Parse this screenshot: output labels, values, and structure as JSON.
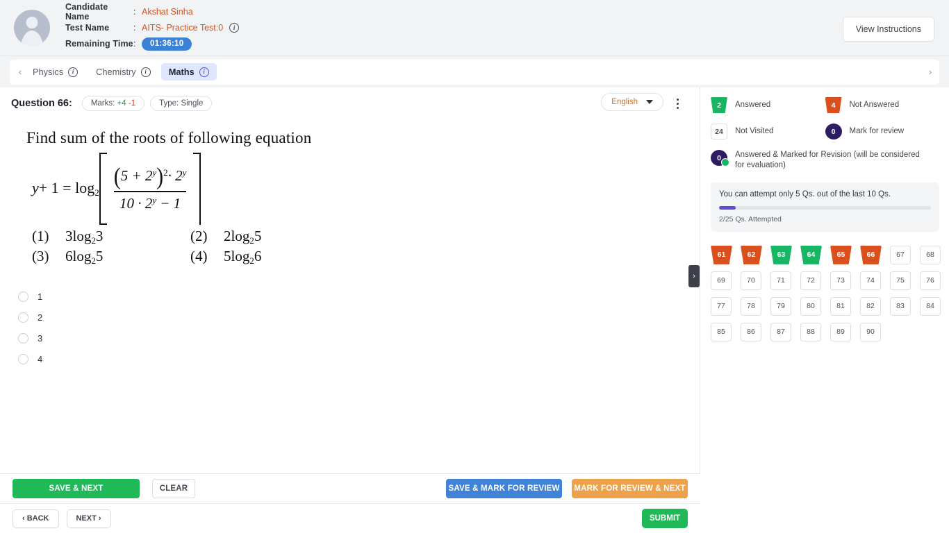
{
  "header": {
    "candidate_label": "Candidate Name",
    "candidate_name": "Akshat Sinha",
    "test_label": "Test Name",
    "test_name": "AITS- Practice Test:0",
    "time_label": "Remaining Time",
    "remaining_time": "01:36:10",
    "colon": ":",
    "view_instructions": "View Instructions",
    "info_glyph": "i"
  },
  "tabs": {
    "prev_arrow": "‹",
    "next_arrow": "›",
    "items": [
      {
        "label": "Physics",
        "active": false
      },
      {
        "label": "Chemistry",
        "active": false
      },
      {
        "label": "Maths",
        "active": true
      }
    ]
  },
  "question": {
    "title": "Question 66:",
    "marks_label": "Marks:",
    "marks_positive": "+4",
    "marks_negative": "-1",
    "type_label": "Type:",
    "type_value": "Single",
    "language": "English",
    "stem": "Find sum of the roots of following equation",
    "equation": {
      "lhs_y": "y",
      "lhs_plus1": "+ 1 =",
      "log": "log",
      "log_base": "2",
      "numerator_open": "(",
      "numerator_5plus2": "5 + 2",
      "numerator_exp_y": "y",
      "numerator_close": ")",
      "numerator_power": "2",
      "numerator_dot2": "· 2",
      "numerator_dot2_exp": "y",
      "denominator": "10 · 2",
      "denominator_exp": "y",
      "denominator_minus": "− 1"
    },
    "image_options": [
      {
        "num": "(1)",
        "text": "3log₂2 3",
        "text_base": "3log",
        "sub": "2",
        "tail": "3"
      },
      {
        "num": "(2)",
        "text": "2log₂2 5",
        "text_base": "2log",
        "sub": "2",
        "tail": "5"
      },
      {
        "num": "(3)",
        "text": "6log₂2 5",
        "text_base": "6log",
        "sub": "2",
        "tail": "5"
      },
      {
        "num": "(4)",
        "text": "5log₂2 6",
        "text_base": "5log",
        "sub": "2",
        "tail": "6"
      }
    ],
    "choices": [
      {
        "label": "1",
        "selected": false
      },
      {
        "label": "2",
        "selected": false
      },
      {
        "label": "3",
        "selected": false
      },
      {
        "label": "4",
        "selected": false
      }
    ],
    "collapse_chevron": "›"
  },
  "actions": {
    "save_next": "SAVE & NEXT",
    "clear": "CLEAR",
    "save_mark_review": "SAVE & MARK FOR REVIEW",
    "mark_review_next": "MARK FOR REVIEW & NEXT",
    "back": "‹ BACK",
    "next": "NEXT ›",
    "submit": "SUBMIT"
  },
  "sidebar": {
    "legend": [
      {
        "count": "2",
        "label": "Answered",
        "kind": "ans"
      },
      {
        "count": "4",
        "label": "Not Answered",
        "kind": "nans"
      },
      {
        "count": "24",
        "label": "Not Visited",
        "kind": "nvis"
      },
      {
        "count": "0",
        "label": "Mark for review",
        "kind": "mark"
      },
      {
        "count": "0",
        "label": "Answered & Marked for Revision (will be considered for evaluation)",
        "kind": "markans"
      }
    ],
    "notice": "You can attempt only 5 Qs. out of the last 10 Qs.",
    "progress_percent": 8,
    "progress_label": "2/25 Qs. Attempted",
    "questions": [
      {
        "n": "61",
        "state": "notanswered"
      },
      {
        "n": "62",
        "state": "notanswered"
      },
      {
        "n": "63",
        "state": "answered"
      },
      {
        "n": "64",
        "state": "answered"
      },
      {
        "n": "65",
        "state": "notanswered"
      },
      {
        "n": "66",
        "state": "notanswered"
      },
      {
        "n": "67",
        "state": "notvisited"
      },
      {
        "n": "68",
        "state": "notvisited"
      },
      {
        "n": "69",
        "state": "notvisited"
      },
      {
        "n": "70",
        "state": "notvisited"
      },
      {
        "n": "71",
        "state": "notvisited"
      },
      {
        "n": "72",
        "state": "notvisited"
      },
      {
        "n": "73",
        "state": "notvisited"
      },
      {
        "n": "74",
        "state": "notvisited"
      },
      {
        "n": "75",
        "state": "notvisited"
      },
      {
        "n": "76",
        "state": "notvisited"
      },
      {
        "n": "77",
        "state": "notvisited"
      },
      {
        "n": "78",
        "state": "notvisited"
      },
      {
        "n": "79",
        "state": "notvisited"
      },
      {
        "n": "80",
        "state": "notvisited"
      },
      {
        "n": "81",
        "state": "notvisited"
      },
      {
        "n": "82",
        "state": "notvisited"
      },
      {
        "n": "83",
        "state": "notvisited"
      },
      {
        "n": "84",
        "state": "notvisited"
      },
      {
        "n": "85",
        "state": "notvisited"
      },
      {
        "n": "86",
        "state": "notvisited"
      },
      {
        "n": "87",
        "state": "notvisited"
      },
      {
        "n": "88",
        "state": "notvisited"
      },
      {
        "n": "89",
        "state": "notvisited"
      },
      {
        "n": "90",
        "state": "notvisited"
      }
    ]
  },
  "colors": {
    "answered_green": "#18b663",
    "not_answered_orange": "#d9501e",
    "mark_purple": "#2d1b63",
    "progress_purple": "#5b4fd4",
    "timer_blue": "#3b82d6",
    "accent_orange_text": "#d4521c",
    "save_green": "#21b858",
    "review_blue": "#4083d6",
    "review_orange": "#eda14a",
    "active_tab_bg": "#dfe6ff"
  }
}
